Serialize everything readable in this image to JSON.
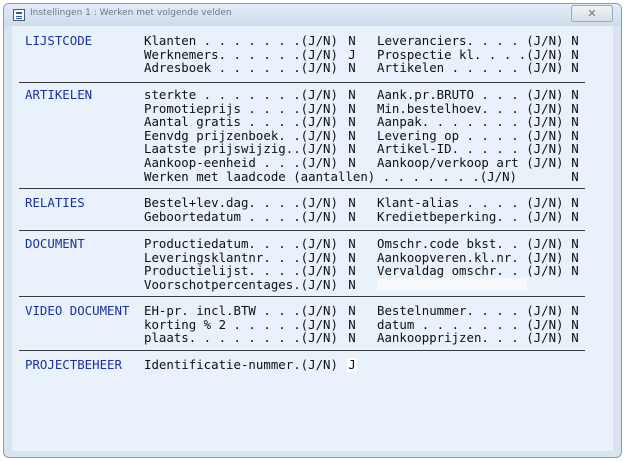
{
  "window": {
    "title": "Instellingen 1 : Werken met volgende velden",
    "close_icon": "✕"
  },
  "sections": [
    {
      "title": "LIJSTCODE",
      "rows": [
        {
          "left": {
            "label": "Klanten . . . . . . .(J/N)",
            "value": "N"
          },
          "right": {
            "label": "Leveranciers. . . . (J/N)",
            "value": "N"
          }
        },
        {
          "left": {
            "label": "Werknemers. . . . . .(J/N)",
            "value": "J"
          },
          "right": {
            "label": "Prospectie kl. . . .(J/N)",
            "value": "N"
          }
        },
        {
          "left": {
            "label": "Adresboek . . . . . .(J/N)",
            "value": "N"
          },
          "right": {
            "label": "Artikelen . . . . . (J/N)",
            "value": "N"
          }
        }
      ]
    },
    {
      "title": "ARTIKELEN",
      "rows": [
        {
          "left": {
            "label": "sterkte . . . . . . .(J/N)",
            "value": "N"
          },
          "right": {
            "label": "Aank.pr.BRUTO . . . (J/N)",
            "value": "N"
          }
        },
        {
          "left": {
            "label": "Promotieprijs . . . .(J/N)",
            "value": "N"
          },
          "right": {
            "label": "Min.bestelhoev. . . (J/N)",
            "value": "N"
          }
        },
        {
          "left": {
            "label": "Aantal gratis . . . .(J/N)",
            "value": "N"
          },
          "right": {
            "label": "Aanpak. . . . . . . (J/N)",
            "value": "N"
          }
        },
        {
          "left": {
            "label": "Eenvdg prijzenboek. .(J/N)",
            "value": "N"
          },
          "right": {
            "label": "Levering op . . . . (J/N)",
            "value": "N"
          }
        },
        {
          "left": {
            "label": "Laatste prijswijzig..(J/N)",
            "value": "N"
          },
          "right": {
            "label": "Artikel-ID. . . . . (J/N)",
            "value": "N"
          }
        },
        {
          "left": {
            "label": "Aankoop-eenheid . . .(J/N)",
            "value": "N"
          },
          "right": {
            "label": "Aankoop/verkoop art (J/N)",
            "value": "N"
          }
        },
        {
          "wide": {
            "label": "Werken met laadcode (aantallen) . . . . . . .(J/N)",
            "value": "N"
          }
        }
      ]
    },
    {
      "title": "RELATIES",
      "rows": [
        {
          "left": {
            "label": "Bestel+lev.dag. . . .(J/N)",
            "value": "N"
          },
          "right": {
            "label": "Klant-alias . . . . (J/N)",
            "value": "N"
          }
        },
        {
          "left": {
            "label": "Geboortedatum . . . .(J/N)",
            "value": "N"
          },
          "right": {
            "label": "Kredietbeperking. . (J/N)",
            "value": "N"
          }
        }
      ]
    },
    {
      "title": "DOCUMENT",
      "rows": [
        {
          "left": {
            "label": "Productiedatum. . . .(J/N)",
            "value": "N"
          },
          "right": {
            "label": "Omschr.code bkst. . (J/N)",
            "value": "N"
          }
        },
        {
          "left": {
            "label": "Leveringsklantnr. . .(J/N)",
            "value": "N"
          },
          "right": {
            "label": "Aankoopveren.kl.nr. (J/N)",
            "value": "N"
          }
        },
        {
          "left": {
            "label": "Productielijst. . . .(J/N)",
            "value": "N"
          },
          "right": {
            "label": "Vervaldag omschr. . (J/N)",
            "value": "N"
          }
        },
        {
          "left": {
            "label": "Voorschotpercentages.(J/N)",
            "value": "N"
          }
        }
      ]
    },
    {
      "title": "VIDEO DOCUMENT",
      "rows": [
        {
          "left": {
            "label": "EH-pr. incl.BTW . . .(J/N)",
            "value": "N"
          },
          "right": {
            "label": "Bestelnummer. . . . (J/N)",
            "value": "N"
          }
        },
        {
          "left": {
            "label": "korting % 2 . . . . .(J/N)",
            "value": "N"
          },
          "right": {
            "label": "datum . . . . . . . (J/N)",
            "value": "N"
          }
        },
        {
          "left": {
            "label": "plaats. . . . . . . .(J/N)",
            "value": "N"
          },
          "right": {
            "label": "Aankoopprijzen. . . (J/N)",
            "value": "N"
          }
        }
      ]
    },
    {
      "title": "PROJECTBEHEER",
      "rows": [
        {
          "left": {
            "label": "Identificatie-nummer.(J/N)",
            "value": "J"
          }
        }
      ]
    }
  ]
}
